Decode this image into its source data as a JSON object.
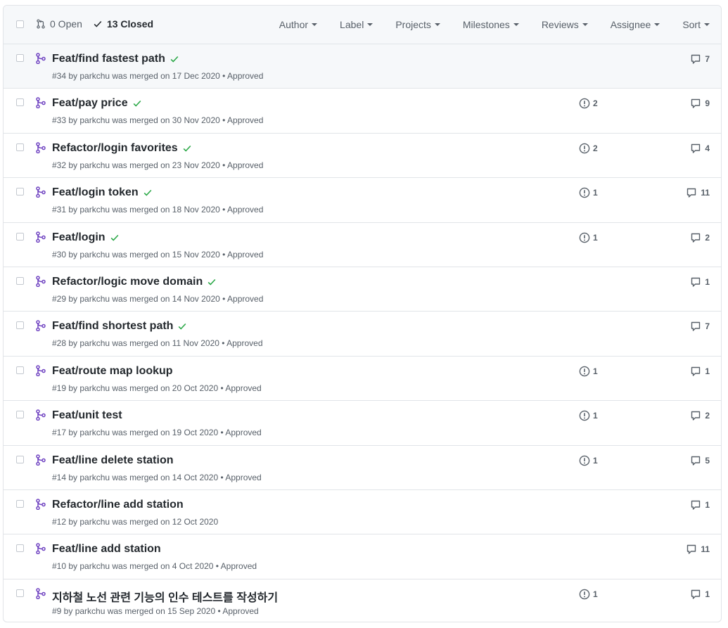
{
  "header": {
    "open_label": "0 Open",
    "closed_label": "13 Closed",
    "filters": [
      "Author",
      "Label",
      "Projects",
      "Milestones",
      "Reviews",
      "Assignee",
      "Sort"
    ]
  },
  "colors": {
    "merged": "#6f42c1",
    "approved_check": "#28a745",
    "muted": "#586069"
  },
  "pull_requests": [
    {
      "title": "Feat/find fastest path",
      "check": true,
      "meta": "#34 by parkchu was merged on 17 Dec 2020 • Approved",
      "issues": "",
      "comments": "7"
    },
    {
      "title": "Feat/pay price",
      "check": true,
      "meta": "#33 by parkchu was merged on 30 Nov 2020 • Approved",
      "issues": "2",
      "comments": "9"
    },
    {
      "title": "Refactor/login favorites",
      "check": true,
      "meta": "#32 by parkchu was merged on 23 Nov 2020 • Approved",
      "issues": "2",
      "comments": "4"
    },
    {
      "title": "Feat/login token",
      "check": true,
      "meta": "#31 by parkchu was merged on 18 Nov 2020 • Approved",
      "issues": "1",
      "comments": "11"
    },
    {
      "title": "Feat/login",
      "check": true,
      "meta": "#30 by parkchu was merged on 15 Nov 2020 • Approved",
      "issues": "1",
      "comments": "2"
    },
    {
      "title": "Refactor/logic move domain",
      "check": true,
      "meta": "#29 by parkchu was merged on 14 Nov 2020 • Approved",
      "issues": "",
      "comments": "1"
    },
    {
      "title": "Feat/find shortest path",
      "check": true,
      "meta": "#28 by parkchu was merged on 11 Nov 2020 • Approved",
      "issues": "",
      "comments": "7"
    },
    {
      "title": "Feat/route map lookup",
      "check": false,
      "meta": "#19 by parkchu was merged on 20 Oct 2020 • Approved",
      "issues": "1",
      "comments": "1"
    },
    {
      "title": "Feat/unit test",
      "check": false,
      "meta": "#17 by parkchu was merged on 19 Oct 2020 • Approved",
      "issues": "1",
      "comments": "2"
    },
    {
      "title": "Feat/line delete station",
      "check": false,
      "meta": "#14 by parkchu was merged on 14 Oct 2020 • Approved",
      "issues": "1",
      "comments": "5"
    },
    {
      "title": "Refactor/line add station",
      "check": false,
      "meta": "#12 by parkchu was merged on 12 Oct 2020",
      "issues": "",
      "comments": "1"
    },
    {
      "title": "Feat/line add station",
      "check": false,
      "meta": "#10 by parkchu was merged on 4 Oct 2020 • Approved",
      "issues": "",
      "comments": "11"
    },
    {
      "title": "지하철 노선 관련 기능의 인수 테스트를 작성하기",
      "check": false,
      "meta": "#9 by parkchu was merged on 15 Sep 2020 • Approved",
      "issues": "1",
      "comments": "1"
    }
  ]
}
